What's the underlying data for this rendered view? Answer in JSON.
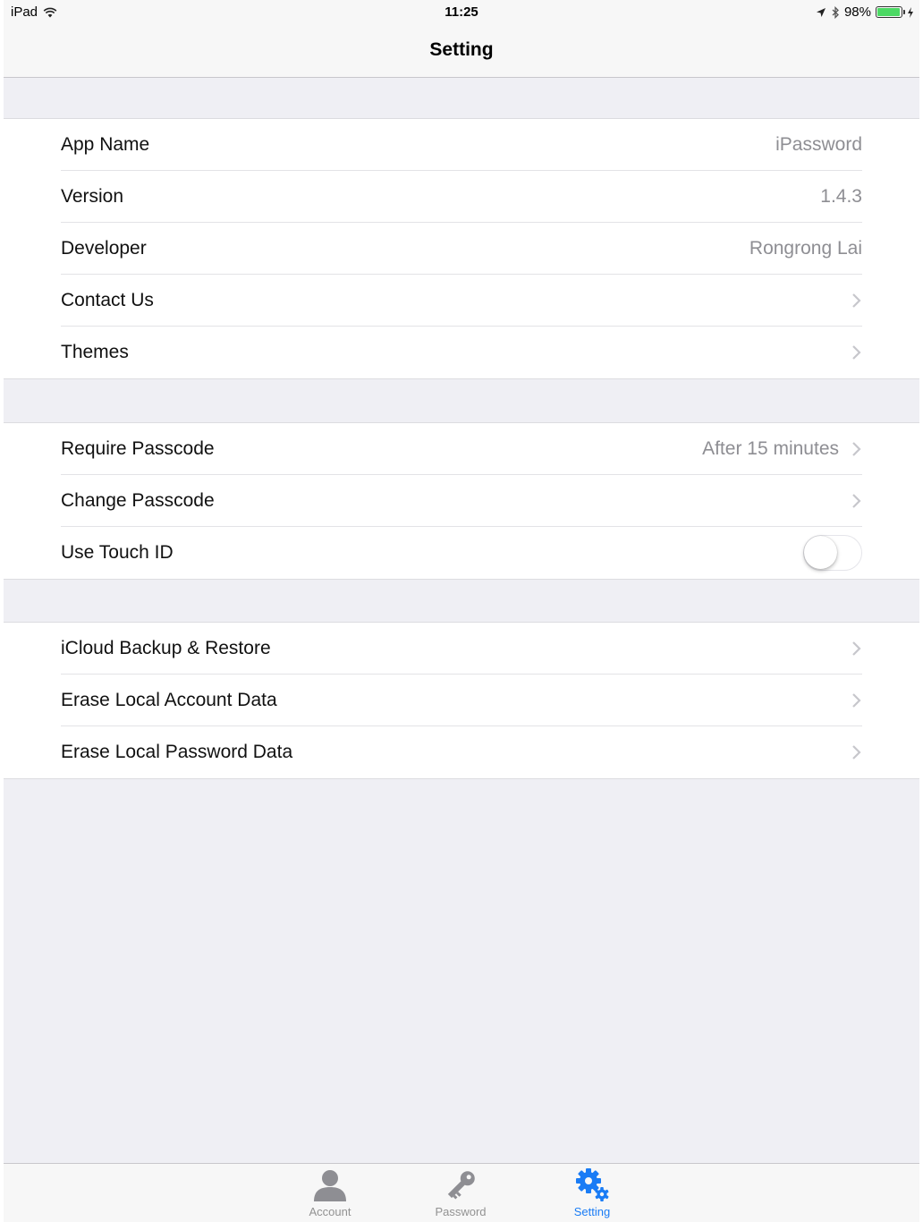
{
  "status_bar": {
    "device": "iPad",
    "time": "11:25",
    "battery": "98%",
    "battery_level": 0.98
  },
  "nav": {
    "title": "Setting"
  },
  "groups": {
    "about": {
      "app_name": {
        "label": "App Name",
        "value": "iPassword"
      },
      "version": {
        "label": "Version",
        "value": "1.4.3"
      },
      "developer": {
        "label": "Developer",
        "value": "Rongrong Lai"
      },
      "contact": {
        "label": "Contact Us"
      },
      "themes": {
        "label": "Themes"
      }
    },
    "security": {
      "require_passcode": {
        "label": "Require Passcode",
        "value": "After 15 minutes"
      },
      "change_passcode": {
        "label": "Change Passcode"
      },
      "touch_id": {
        "label": "Use Touch ID",
        "enabled": false
      }
    },
    "data": {
      "icloud": {
        "label": "iCloud Backup & Restore"
      },
      "erase_account": {
        "label": "Erase Local Account Data"
      },
      "erase_password": {
        "label": "Erase Local Password Data"
      }
    }
  },
  "tabs": [
    {
      "label": "Account",
      "icon": "person-icon",
      "active": false
    },
    {
      "label": "Password",
      "icon": "key-icon",
      "active": false
    },
    {
      "label": "Setting",
      "icon": "gears-icon",
      "active": true
    }
  ],
  "colors": {
    "accent": "#1a7cf5",
    "battery": "#4cd964",
    "background": "#efeff4"
  }
}
